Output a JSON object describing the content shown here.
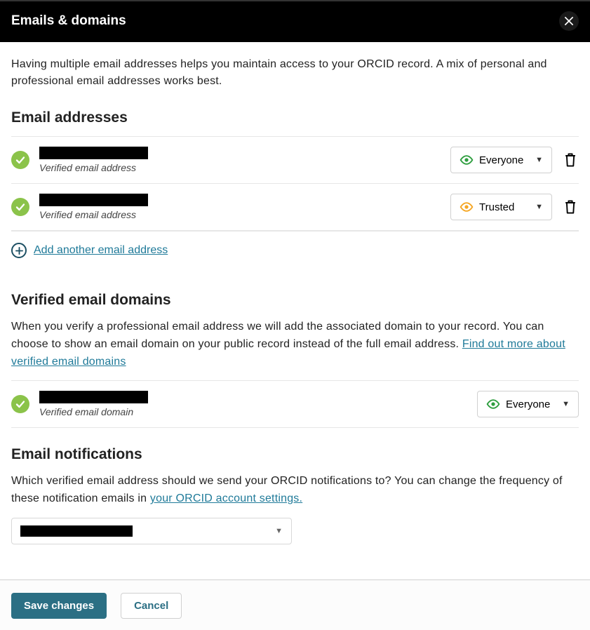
{
  "header": {
    "title": "Emails & domains"
  },
  "intro_text": "Having multiple email addresses helps you maintain access to your ORCID record. A mix of personal and professional email addresses works best.",
  "email_addresses": {
    "heading": "Email addresses",
    "verified_label": "Verified email address",
    "items": [
      {
        "visibility": "Everyone",
        "visibility_color": "green"
      },
      {
        "visibility": "Trusted",
        "visibility_color": "orange"
      }
    ],
    "add_label": "Add another email address"
  },
  "verified_domains": {
    "heading": "Verified email domains",
    "desc_prefix": "When you verify a professional email address we will add the associated domain to your record. You can choose to show an email domain on your public record instead of the full email address. ",
    "link_text": "Find out more about verified email domains",
    "verified_label": "Verified email domain",
    "items": [
      {
        "visibility": "Everyone",
        "visibility_color": "green"
      }
    ]
  },
  "notifications": {
    "heading": "Email notifications",
    "desc_prefix": "Which verified email address should we send your ORCID notifications to? You can change the frequency of these notification emails in ",
    "link_text": "your ORCID account settings."
  },
  "footer": {
    "save_label": "Save changes",
    "cancel_label": "Cancel"
  },
  "colors": {
    "green": "#2e9e3f",
    "orange": "#f5a623"
  }
}
